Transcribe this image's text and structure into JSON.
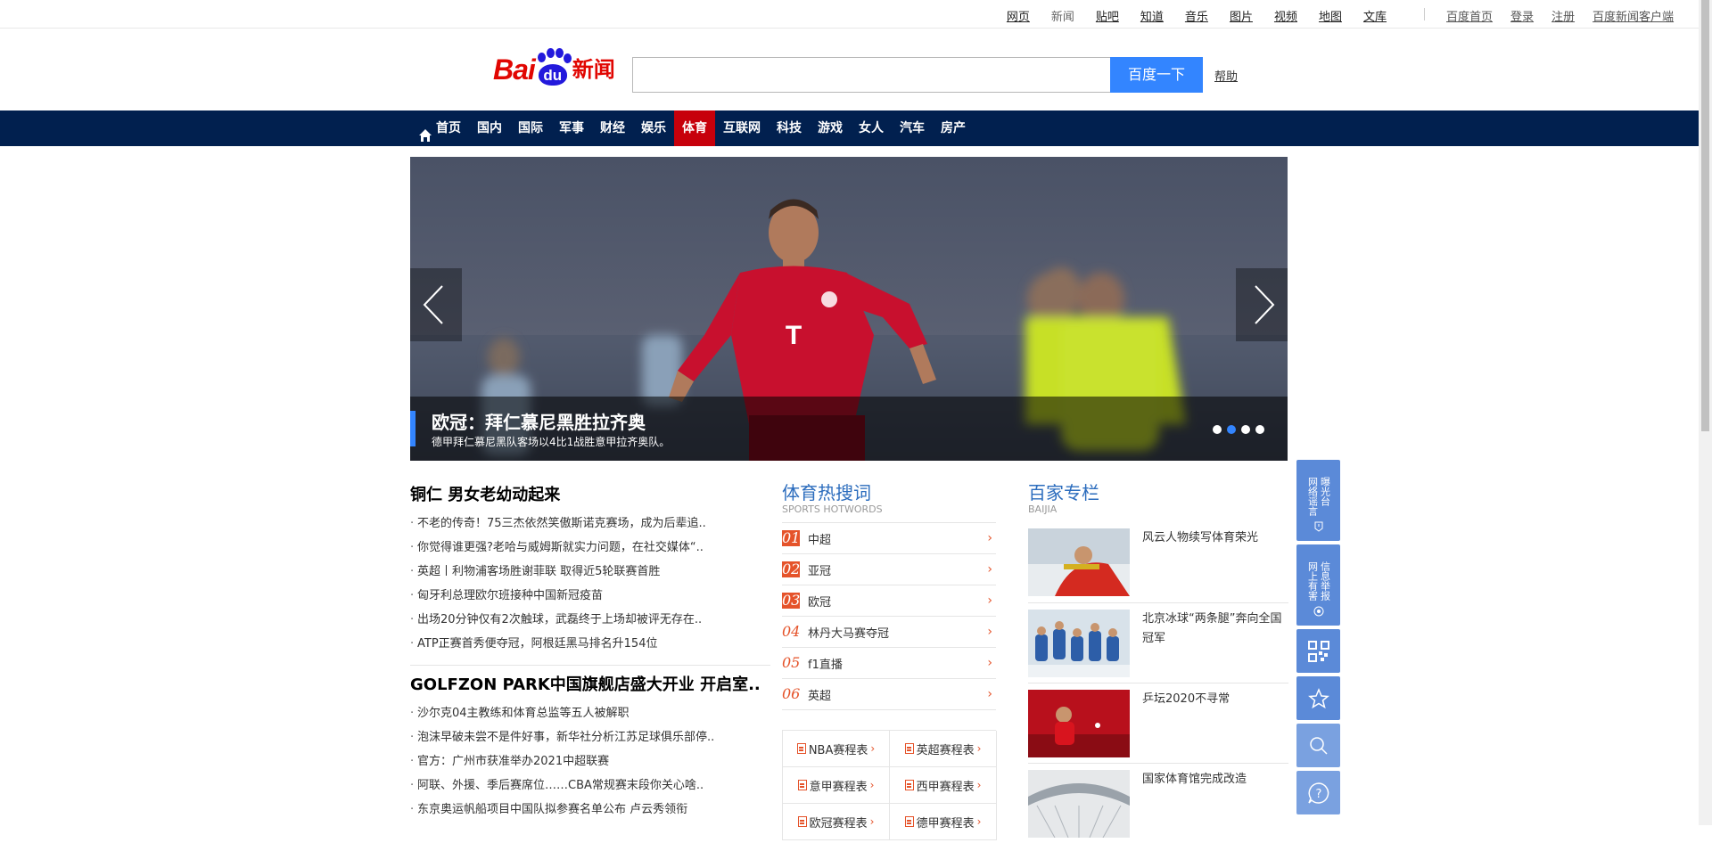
{
  "toplinks": {
    "primary": [
      {
        "label": "网页",
        "current": false
      },
      {
        "label": "新闻",
        "current": true
      },
      {
        "label": "贴吧",
        "current": false
      },
      {
        "label": "知道",
        "current": false
      },
      {
        "label": "音乐",
        "current": false
      },
      {
        "label": "图片",
        "current": false
      },
      {
        "label": "视频",
        "current": false
      },
      {
        "label": "地图",
        "current": false
      },
      {
        "label": "文库",
        "current": false
      }
    ],
    "secondary": [
      "百度首页",
      "登录",
      "注册",
      "百度新闻客户端"
    ]
  },
  "header": {
    "logo_bai": "Bai",
    "logo_du": "du",
    "logo_news": "新闻",
    "search_value": "",
    "search_button": "百度一下",
    "help": "帮助"
  },
  "nav": {
    "home": "首页",
    "items": [
      "国内",
      "国际",
      "军事",
      "财经",
      "娱乐",
      "体育",
      "互联网",
      "科技",
      "游戏",
      "女人",
      "汽车",
      "房产"
    ],
    "active": "体育"
  },
  "slider": {
    "title": "欧冠：拜仁慕尼黑胜拉齐奥",
    "subtitle": "德甲拜仁慕尼黑队客场以4比1战胜意甲拉齐奥队。",
    "dot_count": 4,
    "active_dot": 2,
    "colors": {
      "caption_bar": "#3385ff"
    }
  },
  "left": {
    "blocks": [
      {
        "headline": "铜仁 男女老幼动起来",
        "items": [
          "不老的传奇！75三杰依然笑傲斯诺克赛场，成为后辈追..",
          "你觉得谁更强?老哈与威姆斯就实力问题，在社交媒体“..",
          "英超丨利物浦客场胜谢菲联 取得近5轮联赛首胜",
          "匈牙利总理欧尔班接种中国新冠疫苗",
          "出场20分钟仅有2次触球，武磊终于上场却被评无存在..",
          "ATP正赛首秀便夺冠，阿根廷黑马排名升154位"
        ]
      },
      {
        "headline": "GOLFZON PARK中国旗舰店盛大开业 开启室..",
        "items": [
          "沙尔克04主教练和体育总监等五人被解职",
          "泡沫早破未尝不是件好事，新华社分析江苏足球俱乐部停..",
          "官方：广州市获准举办2021中超联赛",
          "阿联、外援、季后赛席位……CBA常规赛末段你关心啥..",
          "东京奥运帆船项目中国队拟参赛名单公布 卢云秀领衔"
        ]
      }
    ]
  },
  "middle": {
    "title": "体育热搜词",
    "subtitle": "SPORTS HOTWORDS",
    "hotwords": [
      {
        "rank": "01",
        "word": "中超"
      },
      {
        "rank": "02",
        "word": "亚冠"
      },
      {
        "rank": "03",
        "word": "欧冠"
      },
      {
        "rank": "04",
        "word": "林丹大马赛夺冠"
      },
      {
        "rank": "05",
        "word": "f1直播"
      },
      {
        "rank": "06",
        "word": "英超"
      }
    ],
    "schedules": [
      "NBA赛程表",
      "英超赛程表",
      "意甲赛程表",
      "西甲赛程表",
      "欧冠赛程表",
      "德甲赛程表"
    ]
  },
  "right": {
    "title": "百家专栏",
    "subtitle": "BAIJIA",
    "items": [
      {
        "text": "风云人物续写体育荣光"
      },
      {
        "text": "北京冰球“两条腿”奔向全国冠军"
      },
      {
        "text": "乒坛2020不寻常"
      },
      {
        "text": "国家体育馆完成改造"
      }
    ]
  },
  "tools": {
    "report_light": [
      "网络谣言",
      "曝光台"
    ],
    "report_harm": [
      "网上有害",
      "信息举报"
    ],
    "icons": [
      "qrcode-icon",
      "star-icon",
      "search-icon",
      "help-icon"
    ]
  }
}
